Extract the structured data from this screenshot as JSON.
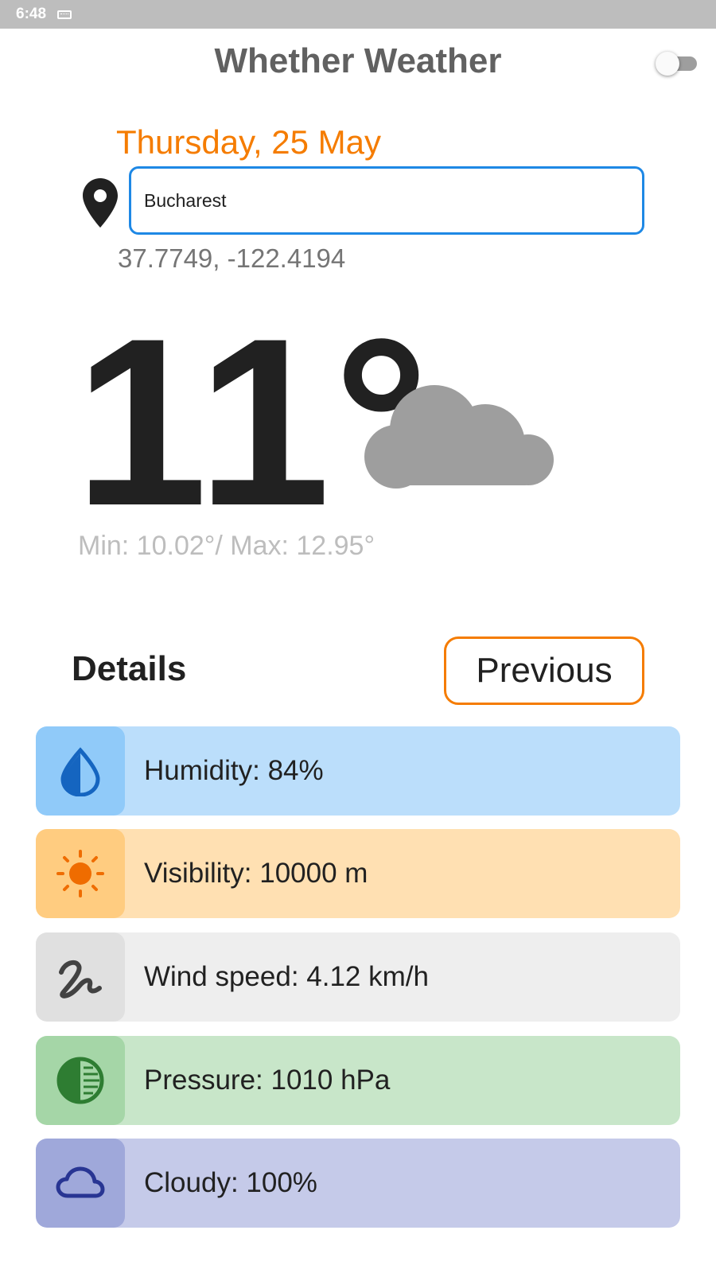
{
  "status_bar": {
    "time": "6:48",
    "keyboard_icon": "keyboard-icon"
  },
  "header": {
    "title": "Whether Weather",
    "theme_toggle_on": false
  },
  "location": {
    "date": "Thursday, 25 May",
    "pin_icon": "location-pin-icon",
    "city_value": "Bucharest",
    "coordinates": "37.7749,  -122.4194"
  },
  "current": {
    "temperature": "11°",
    "condition_icon": "cloud-icon",
    "min_max": "Min: 10.02°/ Max: 12.95°"
  },
  "details": {
    "title": "Details",
    "previous_label": "Previous",
    "items": [
      {
        "label": "Humidity: 84%",
        "icon": "humidity-drop-icon",
        "bg": "#bbdefb",
        "icon_bg": "#90caf9",
        "icon_color": "#1565c0"
      },
      {
        "label": "Visibility: 10000 m",
        "icon": "sun-icon",
        "bg": "#ffe0b2",
        "icon_bg": "#ffcc80",
        "icon_color": "#ef6c00"
      },
      {
        "label": "Wind speed: 4.12 km/h",
        "icon": "wind-icon",
        "bg": "#eeeeee",
        "icon_bg": "#e0e0e0",
        "icon_color": "#424242"
      },
      {
        "label": "Pressure: 1010 hPa",
        "icon": "pressure-gauge-icon",
        "bg": "#c8e6c9",
        "icon_bg": "#a5d6a7",
        "icon_color": "#2e7d32"
      },
      {
        "label": "Cloudy: 100%",
        "icon": "cloud-outline-icon",
        "bg": "#c5cae9",
        "icon_bg": "#9fa8da",
        "icon_color": "#283593"
      }
    ]
  },
  "colors": {
    "accent": "#f57c00",
    "input_border": "#1e88e5",
    "cloud": "#9e9e9e"
  }
}
